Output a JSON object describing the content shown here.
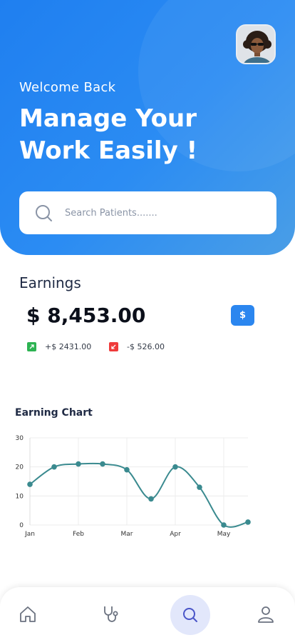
{
  "header": {
    "welcome": "Welcome Back",
    "headline_line1": "Manage Your",
    "headline_line2": "Work Easily !"
  },
  "search": {
    "placeholder": "Search Patients.......",
    "value": ""
  },
  "earnings": {
    "title": "Earnings",
    "amount": "$ 8,453.00",
    "currency_button": "$",
    "increase": "+$ 2431.00",
    "decrease": "-$ 526.00"
  },
  "chart_title": "Earning  Chart",
  "chart_data": {
    "type": "line",
    "x": [
      0,
      0.5,
      1,
      1.5,
      2,
      2.5,
      3,
      3.5,
      4,
      4.5
    ],
    "categories": [
      "Jan",
      "Feb",
      "Mar",
      "Apr",
      "May"
    ],
    "values": [
      14,
      20,
      21,
      21,
      19,
      9,
      20,
      13,
      0,
      1
    ],
    "ylim": [
      0,
      30
    ],
    "yticks": [
      0,
      10,
      20,
      30
    ],
    "grid": true,
    "legend": "none"
  },
  "colors": {
    "primary": "#2b86ef",
    "chart_line": "#3a8a8f",
    "increase": "#2db352",
    "decrease": "#ef3b3b",
    "nav_active_bg": "#e2e7fb",
    "nav_active_icon": "#4a55c8"
  },
  "nav": {
    "items": [
      {
        "icon": "home-icon"
      },
      {
        "icon": "stethoscope-icon"
      },
      {
        "icon": "search-icon",
        "active": true
      },
      {
        "icon": "user-icon"
      }
    ]
  }
}
